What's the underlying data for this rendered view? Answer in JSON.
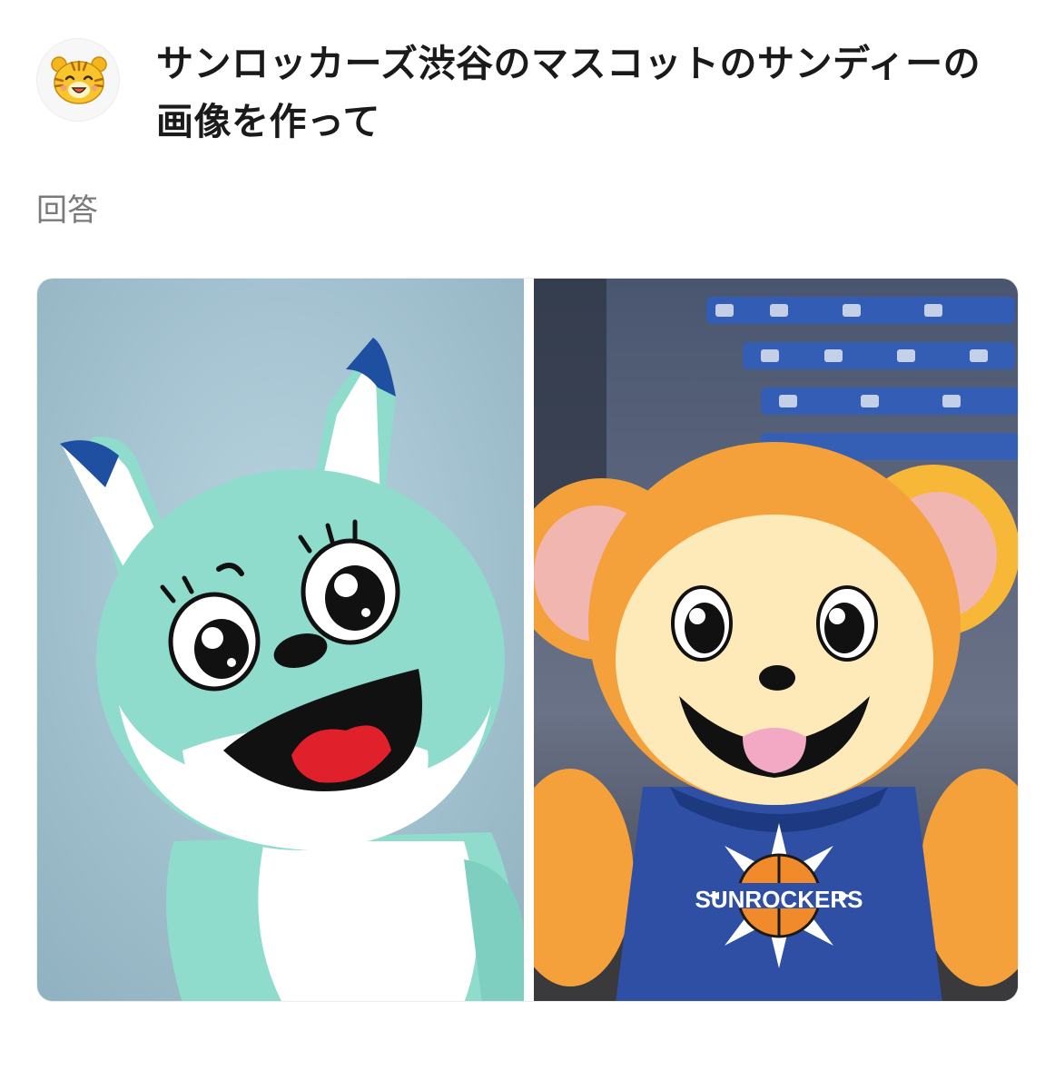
{
  "question": {
    "text": "サンロッカーズ渋谷のマスコットのサンディーの画像を作って"
  },
  "answer": {
    "label": "回答"
  },
  "images": [
    {
      "icon": "fox-mascot-image",
      "background": "#a9c7d4"
    },
    {
      "icon": "bear-mascot-image",
      "background": "#5a6478",
      "jersey_text": "SUNROCKERS"
    }
  ],
  "colors": {
    "fox_body": "#8fdccd",
    "fox_ear_tip": "#1f4fa0",
    "bear_fur": "#f4a13b",
    "bear_face": "#fdeab8",
    "jersey": "#2e4fa3",
    "tongue_red": "#e0202a",
    "tongue_pink": "#f3a9c4"
  }
}
